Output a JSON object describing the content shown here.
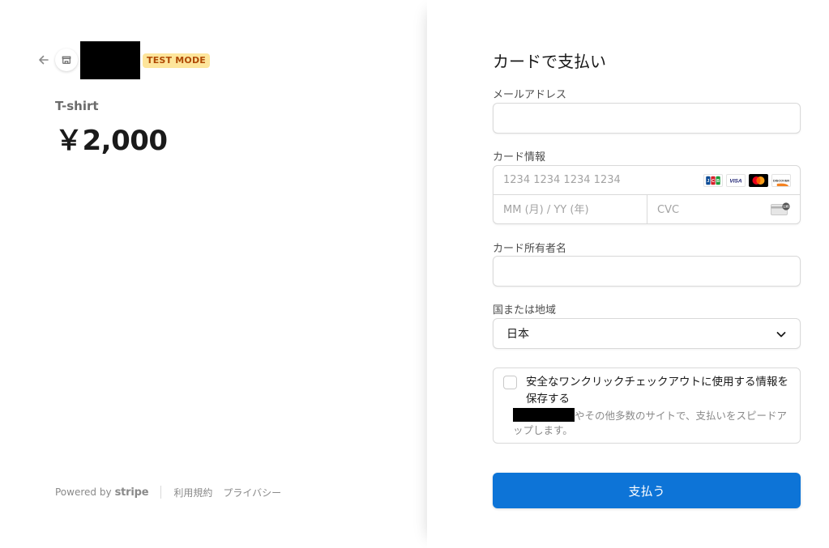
{
  "colors": {
    "accent": "#0d74d7",
    "test_badge_bg": "#fde59b",
    "test_badge_text": "#b04a04"
  },
  "header": {
    "back_icon": "arrow-left-icon",
    "store_icon": "store-icon",
    "test_badge": "TEST MODE"
  },
  "product": {
    "name": "T-shirt",
    "price": "￥2,000"
  },
  "footer": {
    "powered_by": "Powered by",
    "brand": "stripe",
    "terms": "利用規約",
    "privacy": "プライバシー"
  },
  "form": {
    "title": "カードで支払い",
    "email": {
      "label": "メールアドレス",
      "value": "",
      "placeholder": ""
    },
    "card": {
      "label": "カード情報",
      "number_placeholder": "1234 1234 1234 1234",
      "expiry_placeholder": "MM (月) / YY (年)",
      "cvc_placeholder": "CVC",
      "brands": [
        "JCB",
        "VISA",
        "Mastercard",
        "DISCOVER"
      ],
      "cvc_icon_text": "135"
    },
    "cardholder": {
      "label": "カード所有者名",
      "value": "",
      "placeholder": ""
    },
    "country": {
      "label": "国または地域",
      "selected": "日本"
    },
    "save_info": {
      "checked": false,
      "title": "安全なワンクリックチェックアウトに使用する情報を保存する",
      "description": "やその他多数のサイトで、支払いをスピードアップします。"
    },
    "submit_label": "支払う"
  }
}
